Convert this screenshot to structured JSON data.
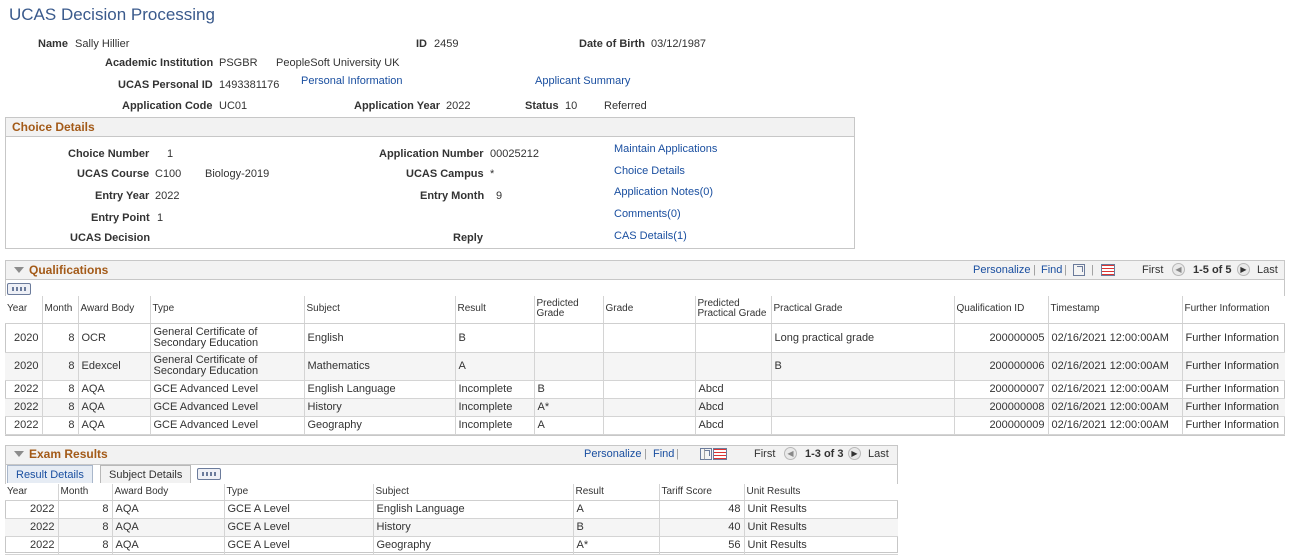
{
  "page": {
    "title": "UCAS Decision Processing"
  },
  "header": {
    "name_label": "Name",
    "name": "Sally Hillier",
    "id_label": "ID",
    "id": "2459",
    "dob_label": "Date of Birth",
    "dob": "03/12/1987",
    "institution_label": "Academic Institution",
    "institution_code": "PSGBR",
    "institution_name": "PeopleSoft University UK",
    "ucas_id_label": "UCAS Personal ID",
    "ucas_id": "1493381176",
    "personal_info_link": "Personal Information",
    "applicant_summary_link": "Applicant Summary",
    "app_code_label": "Application Code",
    "app_code": "UC01",
    "app_year_label": "Application Year",
    "app_year": "2022",
    "status_label": "Status",
    "status_code": "10",
    "status_text": "Referred"
  },
  "choice": {
    "title": "Choice Details",
    "choice_number_label": "Choice Number",
    "choice_number": "1",
    "app_number_label": "Application Number",
    "app_number": "00025212",
    "course_label": "UCAS Course",
    "course_code": "C100",
    "course_name": "Biology-2019",
    "campus_label": "UCAS Campus",
    "campus": "*",
    "entry_year_label": "Entry Year",
    "entry_year": "2022",
    "entry_month_label": "Entry Month",
    "entry_month": "9",
    "entry_point_label": "Entry Point",
    "entry_point": "1",
    "decision_label": "UCAS Decision",
    "reply_label": "Reply",
    "links": [
      "Maintain Applications",
      "Choice Details",
      "Application Notes(0)",
      "Comments(0)",
      "CAS Details(1)"
    ]
  },
  "qualifications": {
    "title": "Qualifications",
    "personalize": "Personalize",
    "find": "Find",
    "first": "First",
    "range": "1-5 of 5",
    "last": "Last",
    "headers": [
      "Year",
      "Month",
      "Award Body",
      "Type",
      "Subject",
      "Result",
      "Predicted Grade",
      "Grade",
      "Predicted Practical Grade",
      "Practical Grade",
      "Qualification ID",
      "Timestamp",
      "Further Information"
    ],
    "rows": [
      [
        "2020",
        "8",
        "OCR",
        "General Certificate of Secondary Education",
        "English",
        "B",
        "",
        "",
        "",
        "Long practical grade",
        "200000005",
        "02/16/2021 12:00:00AM",
        "Further Information"
      ],
      [
        "2020",
        "8",
        "Edexcel",
        "General Certificate of Secondary Education",
        "Mathematics",
        "A",
        "",
        "",
        "",
        "B",
        "200000006",
        "02/16/2021 12:00:00AM",
        "Further Information"
      ],
      [
        "2022",
        "8",
        "AQA",
        "GCE Advanced Level",
        "English Language",
        "Incomplete",
        "B",
        "",
        "Abcd",
        "",
        "200000007",
        "02/16/2021 12:00:00AM",
        "Further Information"
      ],
      [
        "2022",
        "8",
        "AQA",
        "GCE Advanced Level",
        "History",
        "Incomplete",
        "A*",
        "",
        "Abcd",
        "",
        "200000008",
        "02/16/2021 12:00:00AM",
        "Further Information"
      ],
      [
        "2022",
        "8",
        "AQA",
        "GCE Advanced Level",
        "Geography",
        "Incomplete",
        "A",
        "",
        "Abcd",
        "",
        "200000009",
        "02/16/2021 12:00:00AM",
        "Further Information"
      ]
    ]
  },
  "exams": {
    "title": "Exam Results",
    "personalize": "Personalize",
    "find": "Find",
    "first": "First",
    "range": "1-3 of 3",
    "last": "Last",
    "tabs": [
      "Result Details",
      "Subject Details"
    ],
    "headers": [
      "Year",
      "Month",
      "Award Body",
      "Type",
      "Subject",
      "Result",
      "Tariff Score",
      "Unit Results"
    ],
    "rows": [
      [
        "2022",
        "8",
        "AQA",
        "GCE A Level",
        "English Language",
        "A",
        "48",
        "Unit Results"
      ],
      [
        "2022",
        "8",
        "AQA",
        "GCE A Level",
        "History",
        "B",
        "40",
        "Unit Results"
      ],
      [
        "2022",
        "8",
        "AQA",
        "GCE A Level",
        "Geography",
        "A*",
        "56",
        "Unit Results"
      ]
    ]
  },
  "icons": {
    "collapse": "collapse-triangle-icon",
    "zoom": "zoom-icon",
    "grid": "download-grid-icon",
    "prev": "prev-arrow-icon",
    "next": "next-arrow-icon",
    "show_all_tabs": "show-all-columns-icon"
  }
}
